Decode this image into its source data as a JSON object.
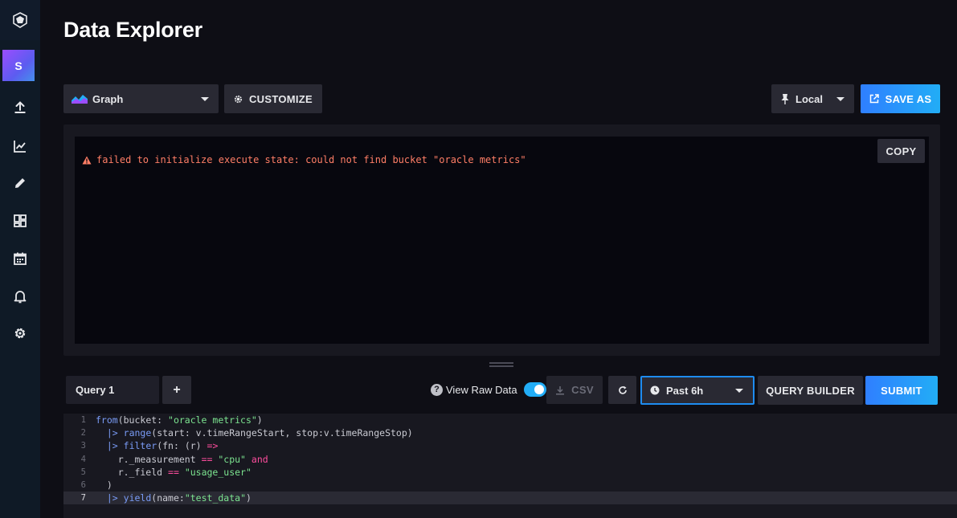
{
  "app": {
    "page_title": "Data Explorer",
    "user_initial": "S"
  },
  "nav": {
    "items": [
      {
        "name": "load-data",
        "icon": "upload-icon"
      },
      {
        "name": "data-explorer",
        "icon": "graph-icon"
      },
      {
        "name": "notebooks",
        "icon": "pencil-icon"
      },
      {
        "name": "dashboards",
        "icon": "dashboard-icon"
      },
      {
        "name": "tasks",
        "icon": "calendar-icon"
      },
      {
        "name": "alerts",
        "icon": "bell-icon"
      },
      {
        "name": "settings",
        "icon": "gear-icon"
      }
    ]
  },
  "toolbar": {
    "graph_type": "Graph",
    "customize_label": "CUSTOMIZE",
    "timezone": "Local",
    "save_as_label": "SAVE AS"
  },
  "result": {
    "error_message": "failed to initialize execute state: could not find bucket \"oracle metrics\"",
    "copy_label": "COPY"
  },
  "query": {
    "tab_label": "Query 1",
    "add_label": "+",
    "view_raw_label": "View Raw Data",
    "view_raw_enabled": true,
    "csv_label": "CSV",
    "time_range": "Past 6h",
    "query_builder_label": "QUERY BUILDER",
    "submit_label": "SUBMIT"
  },
  "editor": {
    "active_line": 7,
    "lines": [
      {
        "num": "1",
        "tokens": [
          [
            "k-fn",
            "from"
          ],
          [
            "k-plain",
            "(bucket: "
          ],
          [
            "k-str",
            "\"oracle metrics\""
          ],
          [
            "k-plain",
            ")"
          ]
        ]
      },
      {
        "num": "2",
        "tokens": [
          [
            "k-plain",
            "  "
          ],
          [
            "k-pipe",
            "|>"
          ],
          [
            "k-plain",
            " "
          ],
          [
            "k-fn",
            "range"
          ],
          [
            "k-plain",
            "(start: v.timeRangeStart, stop:v.timeRangeStop)"
          ]
        ]
      },
      {
        "num": "3",
        "tokens": [
          [
            "k-plain",
            "  "
          ],
          [
            "k-pipe",
            "|>"
          ],
          [
            "k-plain",
            " "
          ],
          [
            "k-fn",
            "filter"
          ],
          [
            "k-plain",
            "(fn: (r) "
          ],
          [
            "k-op",
            "=>"
          ]
        ]
      },
      {
        "num": "4",
        "tokens": [
          [
            "k-plain",
            "    r._measurement "
          ],
          [
            "k-op",
            "=="
          ],
          [
            "k-plain",
            " "
          ],
          [
            "k-str",
            "\"cpu\""
          ],
          [
            "k-plain",
            " "
          ],
          [
            "k-op",
            "and"
          ]
        ]
      },
      {
        "num": "5",
        "tokens": [
          [
            "k-plain",
            "    r._field "
          ],
          [
            "k-op",
            "=="
          ],
          [
            "k-plain",
            " "
          ],
          [
            "k-str",
            "\"usage_user\""
          ]
        ]
      },
      {
        "num": "6",
        "tokens": [
          [
            "k-plain",
            "  )"
          ]
        ]
      },
      {
        "num": "7",
        "tokens": [
          [
            "k-plain",
            "  "
          ],
          [
            "k-pipe",
            "|>"
          ],
          [
            "k-plain",
            " "
          ],
          [
            "k-fn",
            "yield"
          ],
          [
            "k-plain",
            "(name:"
          ],
          [
            "k-str",
            "\"test_data\""
          ],
          [
            "k-plain",
            ")"
          ]
        ]
      }
    ]
  },
  "colors": {
    "accent": "#22adf6",
    "accent_start": "#2f7fff",
    "error": "#ff7e66",
    "background": "#0e0e15"
  }
}
